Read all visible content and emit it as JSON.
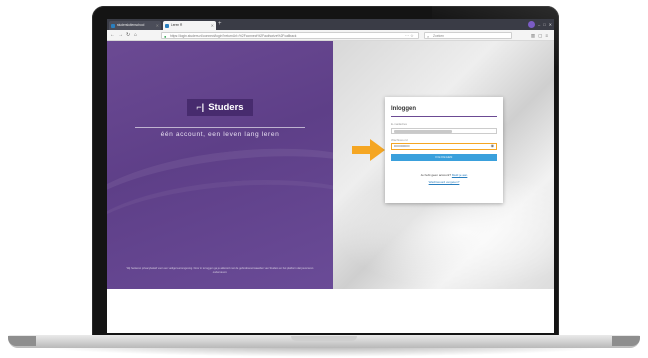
{
  "browser": {
    "tabs": [
      {
        "label": "studersluitenschool"
      },
      {
        "label": "Leren R"
      }
    ],
    "new_tab_label": "+",
    "url": "https://login.studers.nl/connect/login?returnUrl=%2Fconnect%2Fauthorize%2Fcallback",
    "search_placeholder": "Zoeken",
    "controls": {
      "minimize": "–",
      "maximize": "□",
      "close": "✕"
    }
  },
  "brand": {
    "mark": "⌐|",
    "name": "Studers",
    "tagline": "één account, een leven lang leren",
    "colors": {
      "purple": "#6b4a93",
      "accent": "#f5a623",
      "button": "#3aa0dc"
    }
  },
  "footer": {
    "text": "Wij hanteren privacybeleid voor een veilige leeromgeving. Door in te loggen ga je akkoord met de gebruiksvoorwaarden van Studers en het platform dat jouw leren ondersteunt."
  },
  "login": {
    "title": "Inloggen",
    "username_label": "E-mailadres",
    "password_label": "Wachtwoord",
    "password_value": "••••••••••••••",
    "button_label": "INLOGGEN",
    "no_account_text": "Je hebt geen account?",
    "no_account_link": "Meld je aan",
    "forgot_link": "Wachtwoord vergeten?"
  },
  "icons": {
    "back": "back-arrow-icon",
    "forward": "forward-arrow-icon",
    "reload": "reload-icon",
    "home": "home-icon",
    "lock": "lock-icon",
    "search": "search-icon",
    "eye": "eye-icon",
    "pointer": "arrow-pointer-icon"
  }
}
